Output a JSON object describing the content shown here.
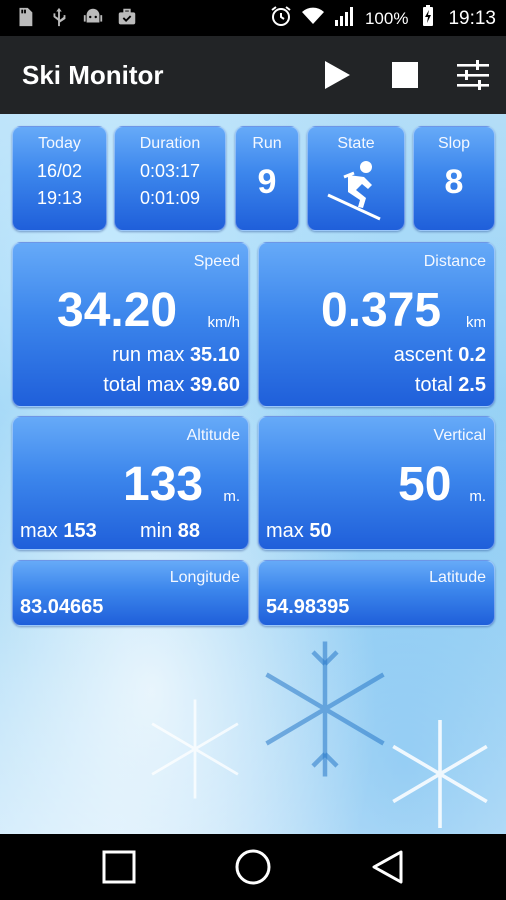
{
  "status_bar": {
    "battery_percent": "100%",
    "time": "19:13",
    "icons": [
      "sd-card-icon",
      "usb-icon",
      "android-debug-icon",
      "briefcase-icon",
      "alarm-icon",
      "wifi-icon",
      "signal-icon",
      "battery-charging-icon"
    ]
  },
  "app_bar": {
    "title": "Ski Monitor",
    "actions": [
      "play-icon",
      "stop-icon",
      "settings-sliders-icon"
    ]
  },
  "today": {
    "label": "Today",
    "date": "16/02",
    "time": "19:13"
  },
  "duration": {
    "label": "Duration",
    "total": "0:03:17",
    "run": "0:01:09"
  },
  "run": {
    "label": "Run",
    "value": "9"
  },
  "state": {
    "label": "State",
    "icon": "skier-icon"
  },
  "slop": {
    "label": "Slop",
    "value": "8"
  },
  "speed": {
    "label": "Speed",
    "value": "34.20",
    "unit": "km/h",
    "run_max_label": "run max",
    "run_max_value": "35.10",
    "total_max_label": "total max",
    "total_max_value": "39.60"
  },
  "distance": {
    "label": "Distance",
    "value": "0.375",
    "unit": "km",
    "ascent_label": "ascent",
    "ascent_value": "0.2",
    "total_label": "total",
    "total_value": "2.5"
  },
  "altitude": {
    "label": "Altitude",
    "value": "133",
    "unit": "m.",
    "max_label": "max",
    "max_value": "153",
    "min_label": "min",
    "min_value": "88"
  },
  "vertical": {
    "label": "Vertical",
    "value": "50",
    "unit": "m.",
    "max_label": "max",
    "max_value": "50"
  },
  "longitude": {
    "label": "Longitude",
    "value": "83.04665"
  },
  "latitude": {
    "label": "Latitude",
    "value": "54.98395"
  },
  "nav_bar": [
    "recents-square-icon",
    "home-circle-icon",
    "back-triangle-icon"
  ],
  "colors": {
    "card_top": "#66aaf8",
    "card_bottom": "#1f5fda",
    "app_bar": "#222426"
  }
}
